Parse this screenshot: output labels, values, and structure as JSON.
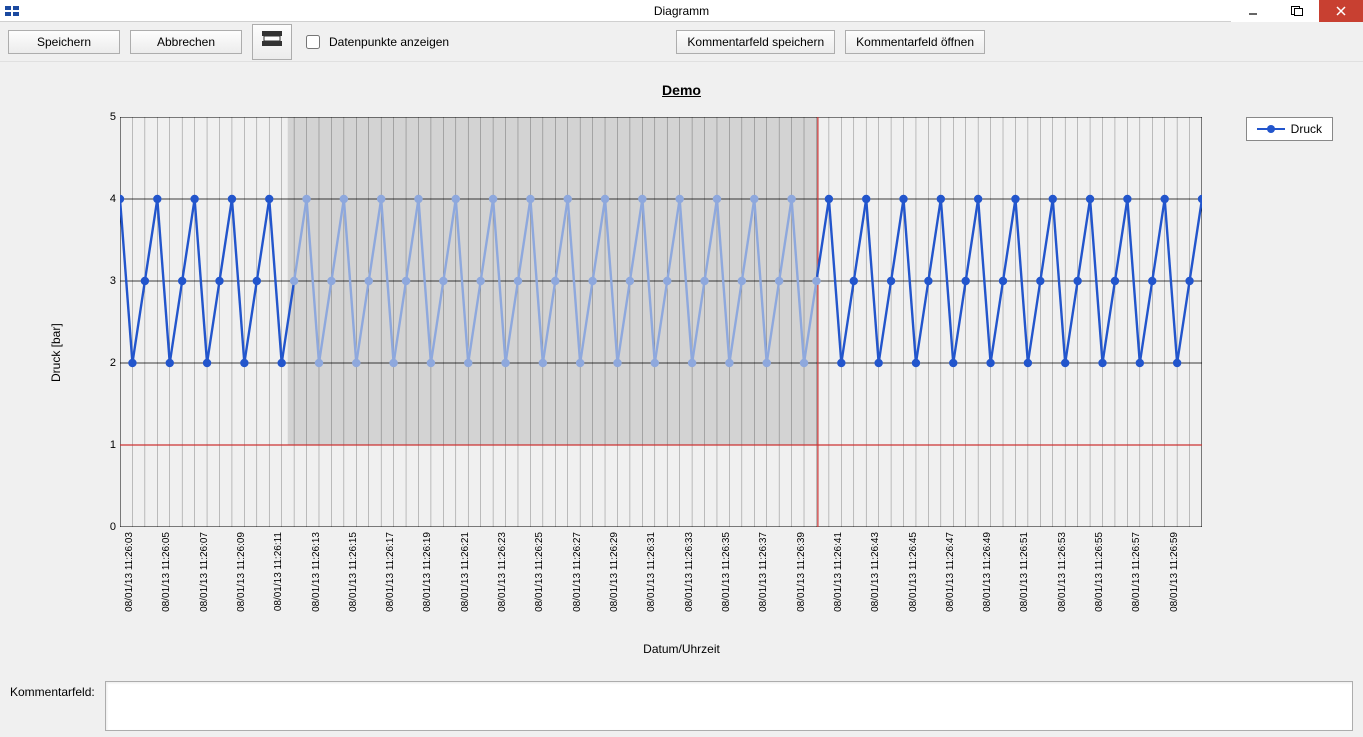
{
  "window": {
    "title": "Diagramm"
  },
  "toolbar": {
    "save_label": "Speichern",
    "cancel_label": "Abbrechen",
    "datapoints_label": "Datenpunkte anzeigen",
    "comment_save_label": "Kommentarfeld speichern",
    "comment_open_label": "Kommentarfeld öffnen"
  },
  "comment": {
    "label": "Kommentarfeld:",
    "value": ""
  },
  "legend": {
    "series_label": "Druck"
  },
  "chart_data": {
    "type": "line",
    "title": "Demo",
    "xlabel": "Datum/Uhrzeit",
    "ylabel": "Druck [bar]",
    "ylim": [
      0,
      5
    ],
    "yticks": [
      0,
      1,
      2,
      3,
      4,
      5
    ],
    "x_labels": [
      "08/01/13 11:26:03",
      "08/01/13 11:26:05",
      "08/01/13 11:26:07",
      "08/01/13 11:26:09",
      "08/01/13 11:26:11",
      "08/01/13 11:26:13",
      "08/01/13 11:26:15",
      "08/01/13 11:26:17",
      "08/01/13 11:26:19",
      "08/01/13 11:26:21",
      "08/01/13 11:26:23",
      "08/01/13 11:26:25",
      "08/01/13 11:26:27",
      "08/01/13 11:26:29",
      "08/01/13 11:26:31",
      "08/01/13 11:26:33",
      "08/01/13 11:26:35",
      "08/01/13 11:26:37",
      "08/01/13 11:26:39",
      "08/01/13 11:26:41",
      "08/01/13 11:26:43",
      "08/01/13 11:26:45",
      "08/01/13 11:26:47",
      "08/01/13 11:26:49",
      "08/01/13 11:26:51",
      "08/01/13 11:26:53",
      "08/01/13 11:26:55",
      "08/01/13 11:26:57",
      "08/01/13 11:26:59"
    ],
    "series": [
      {
        "name": "Druck",
        "color": "#2255cc",
        "values": [
          4,
          2,
          3,
          4,
          2,
          3,
          4,
          2,
          3,
          4,
          2,
          3,
          4,
          2,
          3,
          4,
          2,
          3,
          4,
          2,
          3,
          4,
          2,
          3,
          4,
          2,
          3,
          4,
          2,
          3,
          4,
          2,
          3,
          4,
          2,
          3,
          4,
          2,
          3,
          4,
          2,
          3,
          4,
          2,
          3,
          4,
          2,
          3,
          4,
          2,
          3,
          4,
          2,
          3,
          4,
          2,
          3,
          4,
          2,
          3,
          4,
          2,
          3,
          4,
          2,
          3,
          4,
          2,
          3,
          4,
          2,
          3,
          4,
          2,
          3,
          4,
          2,
          3,
          4,
          2,
          3,
          4,
          2,
          3,
          4,
          2,
          3,
          4
        ]
      }
    ],
    "highlight_band": {
      "x_start_frac": 0.155,
      "x_end_frac": 0.645
    },
    "threshold_lines": [
      {
        "axis": "y",
        "value": 1,
        "color": "#cc3333"
      },
      {
        "axis": "x",
        "frac": 0.645,
        "color": "#cc3333"
      }
    ],
    "minor_x_per_major": 3
  }
}
